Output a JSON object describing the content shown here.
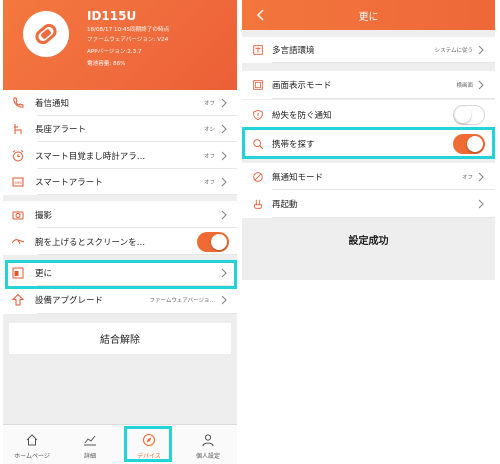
{
  "colors": {
    "accent": "#f06b34",
    "highlight": "#22d3d8",
    "header": "#ef6a3c"
  },
  "device": {
    "id": "ID115U",
    "sync_time": "18/08/17 10:45同期終了の時点",
    "firmware": "ファームウェアバージョン: V24",
    "app_version": "APPバージョン:2.3.7",
    "battery": "電池容量: 86%"
  },
  "left_list": [
    {
      "icon": "phone-icon",
      "label": "着信通知",
      "value": "オフ",
      "control": "chevron"
    },
    {
      "icon": "chair-icon",
      "label": "長座アラート",
      "value": "オン",
      "control": "chevron"
    },
    {
      "icon": "alarm-clock-icon",
      "label": "スマート目覚まし時計アラ…",
      "value": "オフ",
      "control": "chevron"
    },
    {
      "icon": "sms-icon",
      "label": "スマートアラート",
      "value": "オフ",
      "control": "chevron"
    },
    {
      "icon": "camera-icon",
      "label": "撮影",
      "value": "",
      "control": "chevron"
    },
    {
      "icon": "wrist-raise-icon",
      "label": "腕を上げるとスクリーンを…",
      "value": "",
      "control": "toggle",
      "on": true
    },
    {
      "icon": "more-icon",
      "label": "更に",
      "value": "",
      "control": "chevron"
    },
    {
      "icon": "upgrade-icon",
      "label": "設備アプグレード",
      "value": "ファームウェアバージョ…",
      "control": "chevron"
    }
  ],
  "unbind_label": "結合解除",
  "tabs": [
    {
      "icon": "home-icon",
      "label": "ホームページ",
      "active": false
    },
    {
      "icon": "chart-icon",
      "label": "詳細",
      "active": false
    },
    {
      "icon": "compass-icon",
      "label": "デバイス",
      "active": true
    },
    {
      "icon": "person-icon",
      "label": "個人設定",
      "active": false
    }
  ],
  "right": {
    "title": "更に",
    "rows": [
      {
        "icon": "language-icon",
        "label": "多言語環境",
        "value": "システムに従う",
        "control": "chevron"
      },
      {
        "icon": "display-icon",
        "label": "画面表示モード",
        "value": "横画面",
        "control": "chevron"
      },
      {
        "icon": "shield-icon",
        "label": "紛失を防ぐ通知",
        "value": "",
        "control": "toggle",
        "on": false
      },
      {
        "icon": "search-icon",
        "label": "携帯を探す",
        "value": "",
        "control": "toggle",
        "on": true
      },
      {
        "icon": "do-not-disturb-icon",
        "label": "無通知モード",
        "value": "オフ",
        "control": "chevron"
      },
      {
        "icon": "restart-icon",
        "label": "再起動",
        "value": "",
        "control": "chevron"
      }
    ],
    "status": "設定成功"
  }
}
